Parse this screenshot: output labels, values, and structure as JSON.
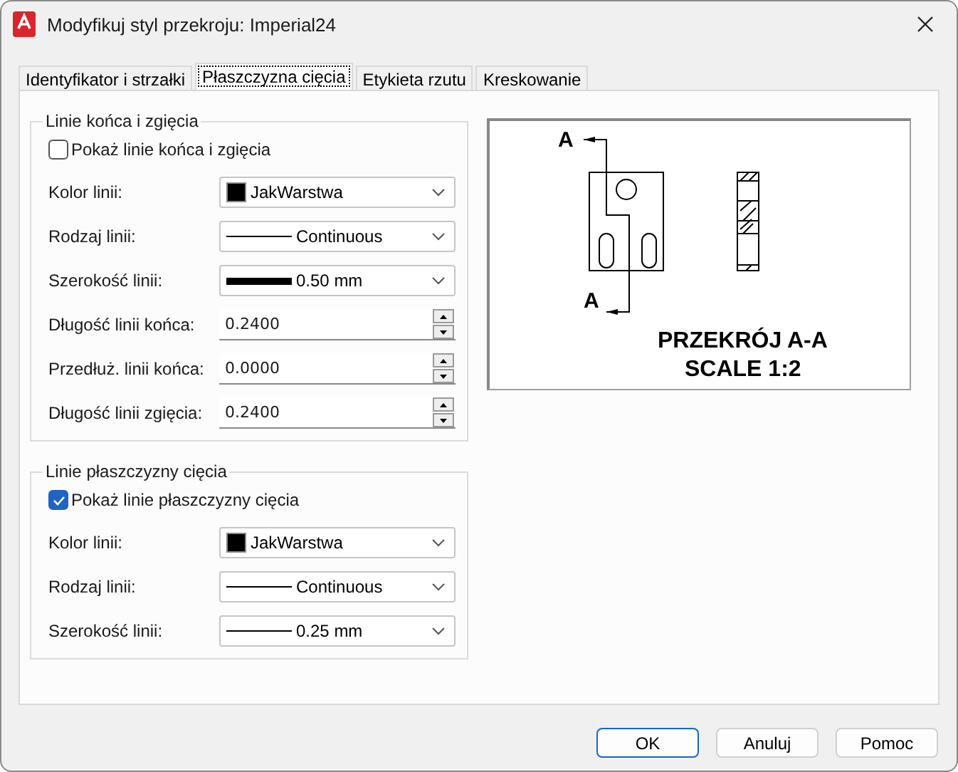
{
  "window": {
    "title": "Modyfikuj styl przekroju: Imperial24"
  },
  "tabs": [
    {
      "label": "Identyfikator i strzałki",
      "selected": false
    },
    {
      "label": "Płaszczyzna cięcia",
      "selected": true
    },
    {
      "label": "Etykieta rzutu",
      "selected": false
    },
    {
      "label": "Kreskowanie",
      "selected": false
    }
  ],
  "groups": [
    {
      "title": "Linie końca i zgięcia",
      "checkbox": {
        "label": "Pokaż linie końca i zgięcia",
        "checked": false
      },
      "fields": [
        {
          "label": "Kolor linii:",
          "kind": "color",
          "color": "#000000",
          "value": "JakWarstwa"
        },
        {
          "label": "Rodzaj linii:",
          "kind": "thinline",
          "value": "Continuous"
        },
        {
          "label": "Szerokość linii:",
          "kind": "thickline",
          "value": "0.50 mm"
        },
        {
          "label": "Długość linii końca:",
          "kind": "number",
          "value": "0.2400"
        },
        {
          "label": "Przedłuż. linii końca:",
          "kind": "number",
          "value": "0.0000"
        },
        {
          "label": "Długość linii zgięcia:",
          "kind": "number",
          "value": "0.2400"
        }
      ]
    },
    {
      "title": "Linie płaszczyzny cięcia",
      "checkbox": {
        "label": "Pokaż linie płaszczyzny cięcia",
        "checked": true
      },
      "fields": [
        {
          "label": "Kolor linii:",
          "kind": "color",
          "color": "#000000",
          "value": "JakWarstwa"
        },
        {
          "label": "Rodzaj linii:",
          "kind": "thinline",
          "value": "Continuous"
        },
        {
          "label": "Szerokość linii:",
          "kind": "thinline",
          "value": "0.25 mm"
        }
      ]
    }
  ],
  "preview": {
    "marker_top": "A",
    "marker_bottom": "A",
    "caption": "PRZEKRÓJ A-A",
    "scale": "SCALE 1:2"
  },
  "buttons": [
    {
      "label": "OK",
      "default": true
    },
    {
      "label": "Anuluj",
      "default": false
    },
    {
      "label": "Pomoc",
      "default": false
    }
  ]
}
